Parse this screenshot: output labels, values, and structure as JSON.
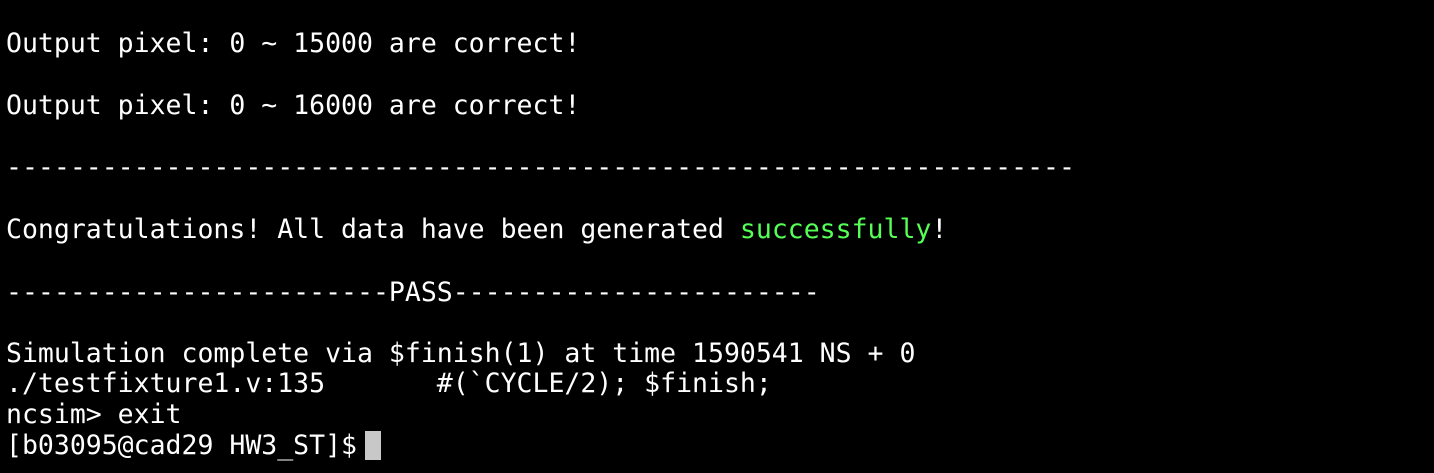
{
  "terminal": {
    "line1": "Output pixel: 0 ~ 15000 are correct!",
    "line2": "Output pixel: 0 ~ 16000 are correct!",
    "line3": "-------------------------------------------------------------------",
    "line4": {
      "before": "Congratulations! All data have been generated ",
      "highlight": "successfully",
      "after": "!"
    },
    "line5": "------------------------PASS-----------------------",
    "line6": "Simulation complete via $finish(1) at time 1590541 NS + 0",
    "line7": "./testfixture1.v:135       #(`CYCLE/2); $finish;",
    "line8": "ncsim> exit",
    "prompt": "[b03095@cad29 HW3_ST]$"
  },
  "colors": {
    "background": "#000000",
    "text": "#ffffff",
    "success": "#55ff55",
    "cursor": "#c8c8c8"
  }
}
